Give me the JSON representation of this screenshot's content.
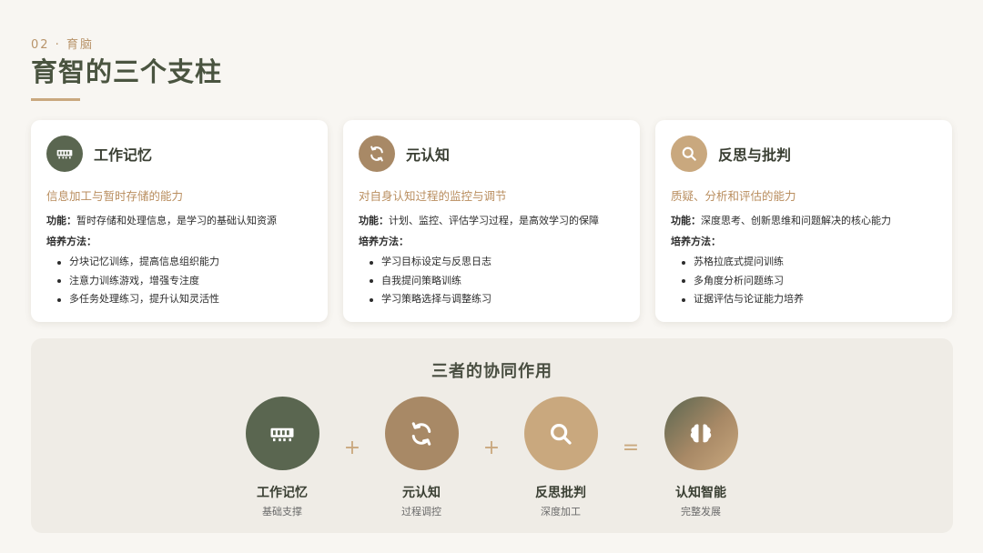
{
  "header": {
    "eyebrow": "02 · 育脑",
    "title": "育智的三个支柱"
  },
  "colors": {
    "green": "#5a6650",
    "brown": "#a88966",
    "tan": "#c9a87e",
    "accent": "#b98e5f"
  },
  "pillars": [
    {
      "icon": "memory-icon",
      "title": "工作记忆",
      "subtitle": "信息加工与暂时存储的能力",
      "function_label": "功能：",
      "function_text": "暂时存储和处理信息，是学习的基础认知资源",
      "method_label": "培养方法：",
      "methods": [
        "分块记忆训练，提高信息组织能力",
        "注意力训练游戏，增强专注度",
        "多任务处理练习，提升认知灵活性"
      ]
    },
    {
      "icon": "sync-icon",
      "title": "元认知",
      "subtitle": "对自身认知过程的监控与调节",
      "function_label": "功能：",
      "function_text": "计划、监控、评估学习过程，是高效学习的保障",
      "method_label": "培养方法：",
      "methods": [
        "学习目标设定与反思日志",
        "自我提问策略训练",
        "学习策略选择与调整练习"
      ]
    },
    {
      "icon": "search-icon",
      "title": "反思与批判",
      "subtitle": "质疑、分析和评估的能力",
      "function_label": "功能：",
      "function_text": "深度思考、创新思维和问题解决的核心能力",
      "method_label": "培养方法：",
      "methods": [
        "苏格拉底式提问训练",
        "多角度分析问题练习",
        "证据评估与论证能力培养"
      ]
    }
  ],
  "synergy": {
    "title": "三者的协同作用",
    "nodes": [
      {
        "icon": "memory-icon",
        "label": "工作记忆",
        "sub": "基础支撑"
      },
      {
        "icon": "sync-icon",
        "label": "元认知",
        "sub": "过程调控"
      },
      {
        "icon": "search-icon",
        "label": "反思批判",
        "sub": "深度加工"
      },
      {
        "icon": "brain-icon",
        "label": "认知智能",
        "sub": "完整发展"
      }
    ],
    "operators": [
      "+",
      "+",
      "="
    ]
  }
}
